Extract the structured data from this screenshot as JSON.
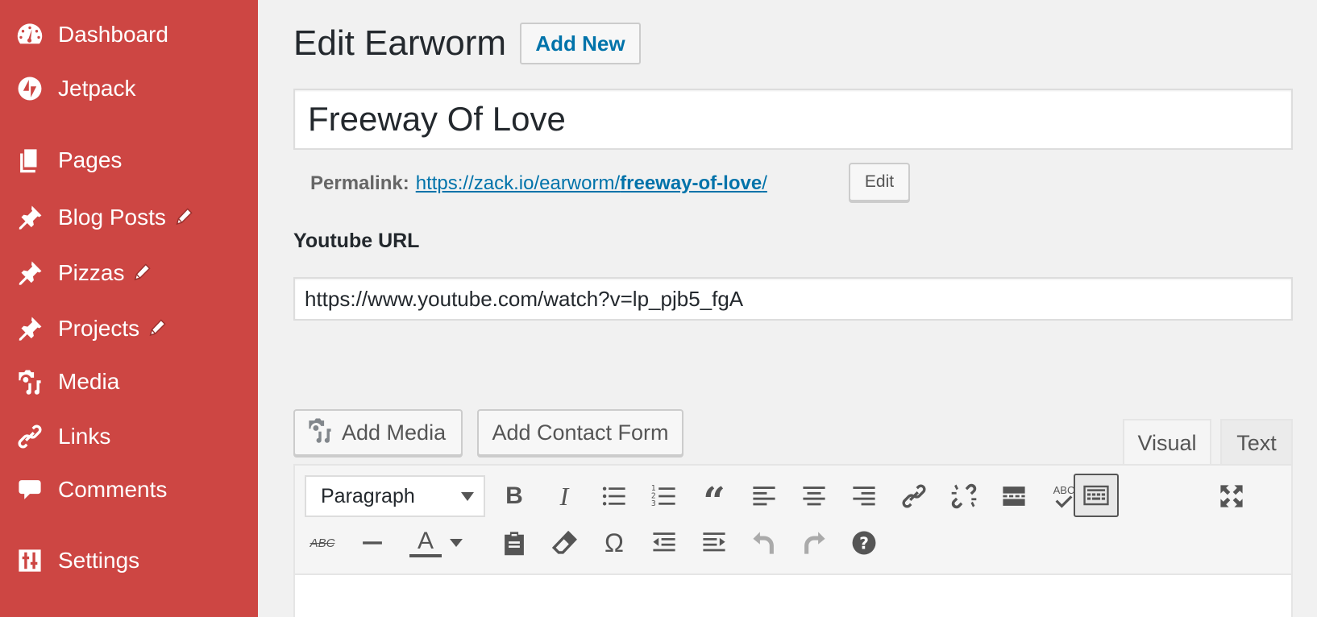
{
  "sidebar": {
    "items": [
      {
        "label": "Dashboard",
        "icon": "dashboard-icon"
      },
      {
        "label": "Jetpack",
        "icon": "jetpack-icon"
      },
      {
        "label": "Pages",
        "icon": "pages-icon"
      },
      {
        "label": "Blog Posts",
        "icon": "pin-icon",
        "has_pencil": true
      },
      {
        "label": "Pizzas",
        "icon": "pin-icon",
        "has_pencil": true
      },
      {
        "label": "Projects",
        "icon": "pin-icon",
        "has_pencil": true
      },
      {
        "label": "Media",
        "icon": "media-icon"
      },
      {
        "label": "Links",
        "icon": "links-icon"
      },
      {
        "label": "Comments",
        "icon": "comments-icon"
      },
      {
        "label": "Settings",
        "icon": "settings-icon"
      }
    ]
  },
  "header": {
    "title": "Edit Earworm",
    "add_new_label": "Add New"
  },
  "post": {
    "title": "Freeway Of Love",
    "permalink_label": "Permalink:",
    "permalink_base": "https://zack.io/earworm/",
    "permalink_slug": "freeway-of-love",
    "permalink_trail": "/",
    "permalink_edit_label": "Edit"
  },
  "fields": {
    "youtube_label": "Youtube URL",
    "youtube_value": "https://www.youtube.com/watch?v=lp_pjb5_fgA"
  },
  "editor": {
    "add_media_label": "Add Media",
    "add_contact_form_label": "Add Contact Form",
    "tab_visual": "Visual",
    "tab_text": "Text",
    "format_value": "Paragraph",
    "spellcheck_label": "ABC",
    "strikethrough_label": "ABC",
    "text_color_glyph": "A",
    "special_char_glyph": "Ω",
    "quote_glyph": "“",
    "active_tab": "Visual"
  },
  "colors": {
    "sidebar_bg": "#cd4643",
    "link": "#0073aa",
    "page_bg": "#f1f1f1"
  }
}
